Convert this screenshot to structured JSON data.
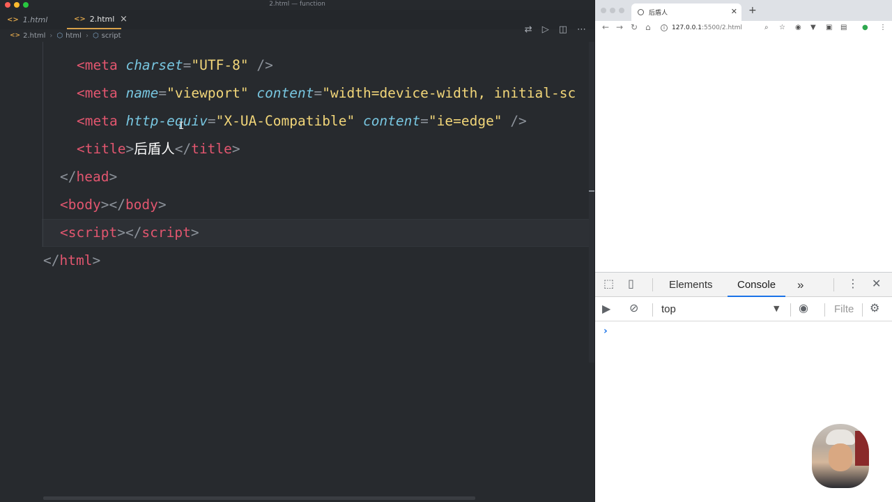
{
  "editor": {
    "window_title": "2.html — function",
    "tabs": [
      {
        "label": "1.html",
        "active": false
      },
      {
        "label": "2.html",
        "active": true
      }
    ],
    "tab_close": "×",
    "breadcrumb": [
      "2.html",
      "html",
      "script"
    ],
    "code_lines": [
      {
        "indent": 4,
        "tokens": [
          [
            "tg",
            "<meta"
          ],
          [
            "tx",
            " "
          ],
          [
            "at",
            "charset"
          ],
          [
            "pu",
            "="
          ],
          [
            "st",
            "\"UTF-8\""
          ],
          [
            "tx",
            " "
          ],
          [
            "pu",
            "/>"
          ]
        ]
      },
      {
        "indent": 4,
        "tokens": [
          [
            "tg",
            "<meta"
          ],
          [
            "tx",
            " "
          ],
          [
            "at",
            "name"
          ],
          [
            "pu",
            "="
          ],
          [
            "st",
            "\"viewport\""
          ],
          [
            "tx",
            " "
          ],
          [
            "at",
            "content"
          ],
          [
            "pu",
            "="
          ],
          [
            "st",
            "\"width=device-width, initial-sc"
          ]
        ]
      },
      {
        "indent": 4,
        "tokens": [
          [
            "tg",
            "<meta"
          ],
          [
            "tx",
            " "
          ],
          [
            "at",
            "http-equiv"
          ],
          [
            "pu",
            "="
          ],
          [
            "st",
            "\"X-UA-Compatible\""
          ],
          [
            "tx",
            " "
          ],
          [
            "at",
            "content"
          ],
          [
            "pu",
            "="
          ],
          [
            "st",
            "\"ie=edge\""
          ],
          [
            "tx",
            " "
          ],
          [
            "pu",
            "/>"
          ]
        ]
      },
      {
        "indent": 4,
        "tokens": [
          [
            "tg",
            "<title"
          ],
          [
            "pu",
            ">"
          ],
          [
            "tx",
            "后盾人"
          ],
          [
            "pu",
            "</"
          ],
          [
            "tg",
            "title"
          ],
          [
            "pu",
            ">"
          ]
        ]
      },
      {
        "indent": 2,
        "tokens": [
          [
            "pu",
            "</"
          ],
          [
            "tg",
            "head"
          ],
          [
            "pu",
            ">"
          ]
        ]
      },
      {
        "indent": 2,
        "tokens": [
          [
            "tg",
            "<body"
          ],
          [
            "pu",
            ">"
          ],
          [
            "pu",
            "</"
          ],
          [
            "tg",
            "body"
          ],
          [
            "pu",
            ">"
          ]
        ]
      },
      {
        "indent": 2,
        "tokens": [
          [
            "tg",
            "<script"
          ],
          [
            "pu",
            ">"
          ],
          [
            "pu",
            "</"
          ],
          [
            "tg",
            "script"
          ],
          [
            "pu",
            ">"
          ]
        ]
      },
      {
        "indent": 0,
        "tokens": [
          [
            "pu",
            "</"
          ],
          [
            "tg",
            "html"
          ],
          [
            "pu",
            ">"
          ]
        ]
      }
    ]
  },
  "browser": {
    "tab_title": "后盾人",
    "url_host": "127.0.0.1",
    "url_path": ":5500/2.html",
    "devtools": {
      "tabs": [
        "Elements",
        "Console"
      ],
      "more": "»",
      "context": "top",
      "filter_placeholder": "Filte",
      "prompt": "›"
    }
  }
}
